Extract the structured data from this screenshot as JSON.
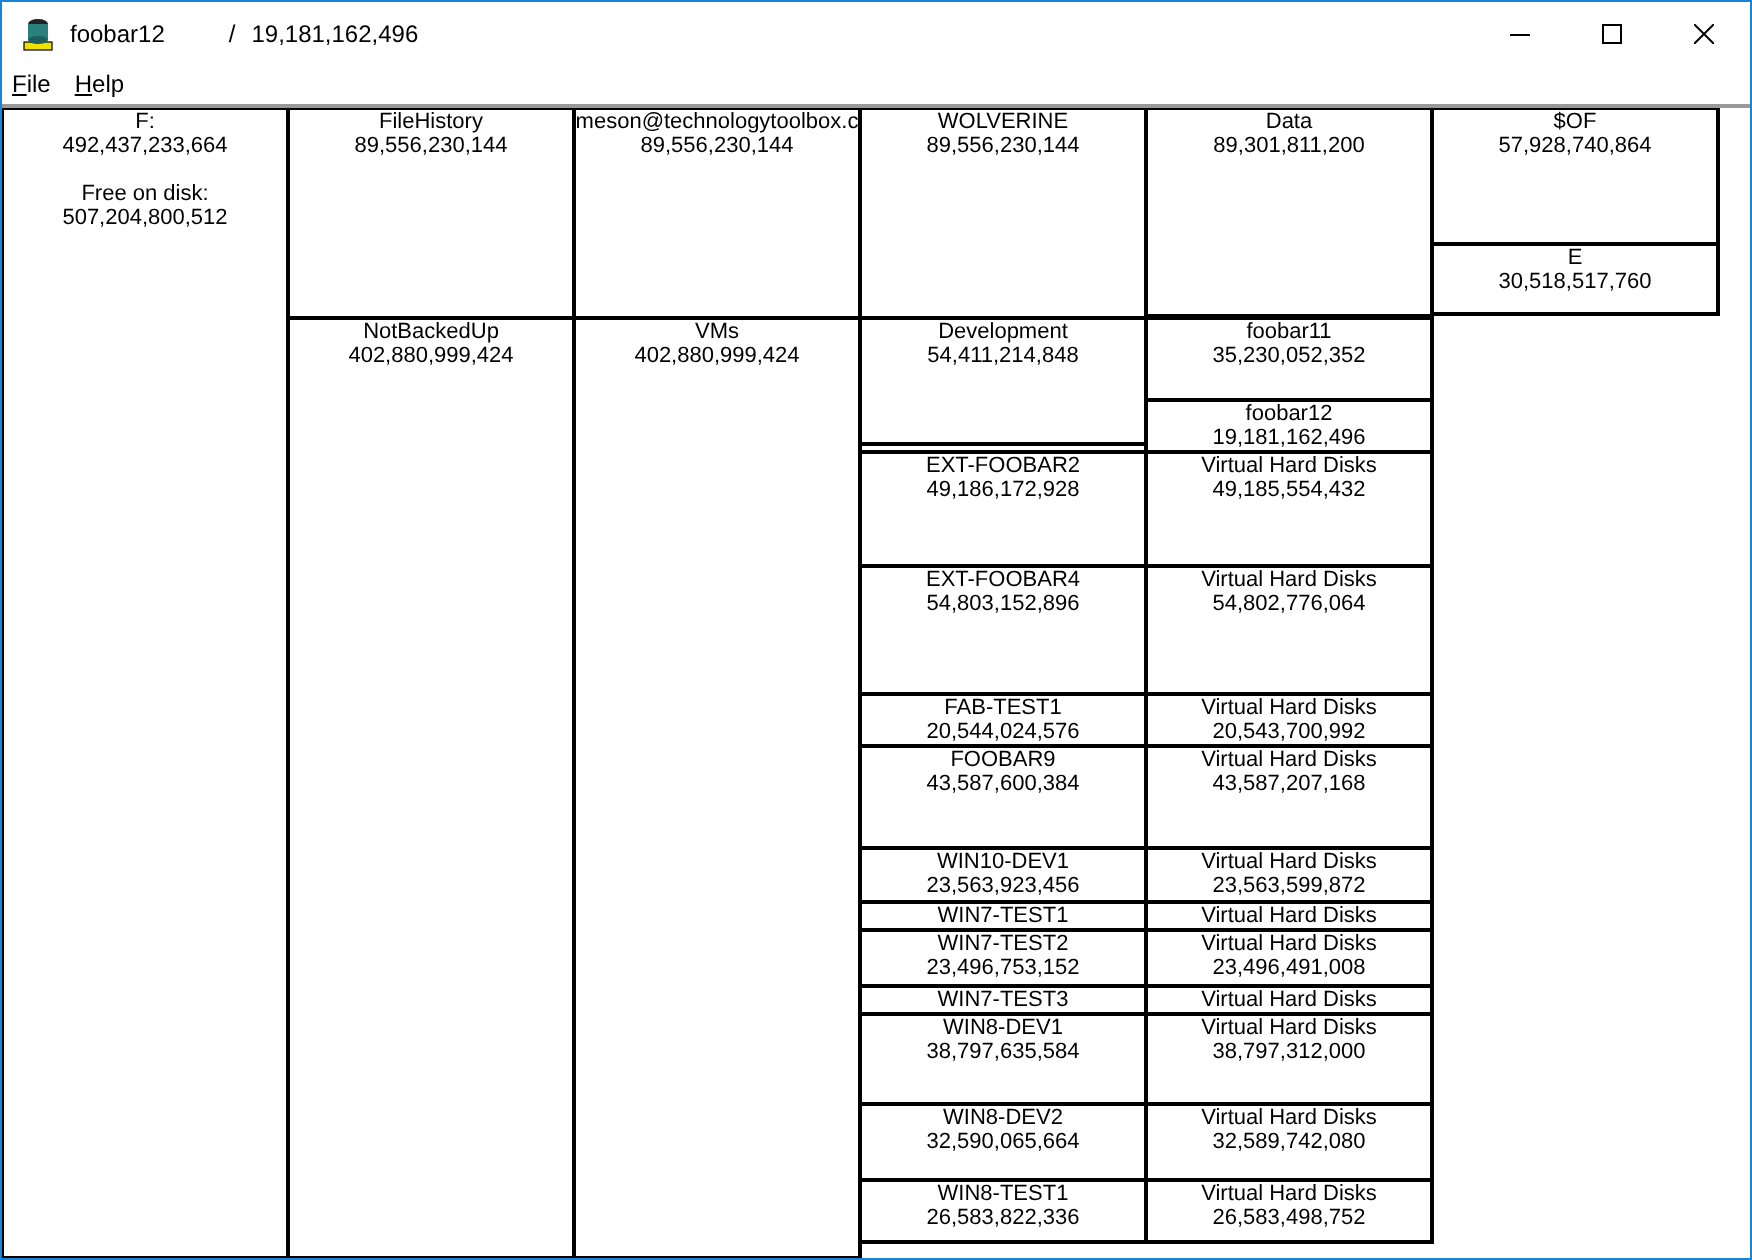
{
  "window": {
    "title": "foobar12",
    "separator": "/",
    "size": "19,181,162,496"
  },
  "menu": [
    {
      "label": "File"
    },
    {
      "label": "Help"
    }
  ],
  "tree": {
    "name": "F:",
    "size": "492,437,233,664",
    "free_label": "Free on disk:",
    "free_size": "507,204,800,512",
    "children": [
      {
        "name": "FileHistory",
        "size": "89,556,230,144",
        "children": [
          {
            "name": "meson@technologytoolbox.c",
            "size": "89,556,230,144",
            "children": [
              {
                "name": "WOLVERINE",
                "size": "89,556,230,144",
                "children": [
                  {
                    "name": "Data",
                    "size": "89,301,811,200",
                    "children": [
                      {
                        "name": "$OF",
                        "size": "57,928,740,864"
                      },
                      {
                        "name": "E",
                        "size": "30,518,517,760"
                      }
                    ]
                  }
                ]
              }
            ]
          }
        ]
      },
      {
        "name": "NotBackedUp",
        "size": "402,880,999,424",
        "children": [
          {
            "name": "VMs",
            "size": "402,880,999,424",
            "children": [
              {
                "name": "Development",
                "size": "54,411,214,848",
                "children": [
                  {
                    "name": "foobar11",
                    "size": "35,230,052,352"
                  },
                  {
                    "name": "foobar12",
                    "size": "19,181,162,496"
                  }
                ]
              },
              {
                "name": "EXT-FOOBAR2",
                "size": "49,186,172,928",
                "children": [
                  {
                    "name": "Virtual Hard Disks",
                    "size": "49,185,554,432"
                  }
                ]
              },
              {
                "name": "EXT-FOOBAR4",
                "size": "54,803,152,896",
                "children": [
                  {
                    "name": "Virtual Hard Disks",
                    "size": "54,802,776,064"
                  }
                ]
              },
              {
                "name": "FAB-TEST1",
                "size": "20,544,024,576",
                "children": [
                  {
                    "name": "Virtual Hard Disks",
                    "size": "20,543,700,992"
                  }
                ]
              },
              {
                "name": "FOOBAR9",
                "size": "43,587,600,384",
                "children": [
                  {
                    "name": "Virtual Hard Disks",
                    "size": "43,587,207,168"
                  }
                ]
              },
              {
                "name": "WIN10-DEV1",
                "size": "23,563,923,456",
                "children": [
                  {
                    "name": "Virtual Hard Disks",
                    "size": "23,563,599,872"
                  }
                ]
              },
              {
                "name": "WIN7-TEST1",
                "children": [
                  {
                    "name": "Virtual Hard Disks"
                  }
                ]
              },
              {
                "name": "WIN7-TEST2",
                "size": "23,496,753,152",
                "children": [
                  {
                    "name": "Virtual Hard Disks",
                    "size": "23,496,491,008"
                  }
                ]
              },
              {
                "name": "WIN7-TEST3",
                "children": [
                  {
                    "name": "Virtual Hard Disks"
                  }
                ]
              },
              {
                "name": "WIN8-DEV1",
                "size": "38,797,635,584",
                "children": [
                  {
                    "name": "Virtual Hard Disks",
                    "size": "38,797,312,000"
                  }
                ]
              },
              {
                "name": "WIN8-DEV2",
                "size": "32,590,065,664",
                "children": [
                  {
                    "name": "Virtual Hard Disks",
                    "size": "32,589,742,080"
                  }
                ]
              },
              {
                "name": "WIN8-TEST1",
                "size": "26,583,822,336",
                "children": [
                  {
                    "name": "Virtual Hard Disks",
                    "size": "26,583,498,752"
                  }
                ]
              }
            ]
          }
        ]
      }
    ]
  }
}
